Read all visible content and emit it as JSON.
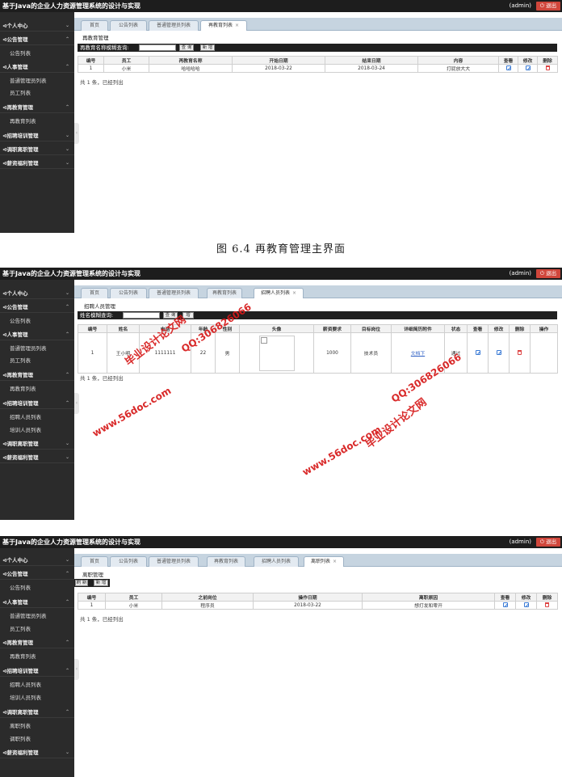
{
  "app": {
    "title": "基于Java的企业人力资源管理系统的设计与实现",
    "user": "(admin)",
    "logout": "退出"
  },
  "sidebar_groups": {
    "personal": "个人中心",
    "notice": "公告管理",
    "notice_list": "公告列表",
    "hr": "人事管理",
    "hr_admins": "普通管理员列表",
    "hr_employees": "员工列表",
    "reedu": "再教育管理",
    "reedu_list": "再教育列表",
    "recruit": "招聘培训管理",
    "recruit_list": "招聘人员列表",
    "train_list": "培训人员列表",
    "transfer": "调职离职管理",
    "leave_list": "离职列表",
    "transfer_list": "调职列表",
    "salary": "薪资福利管理"
  },
  "tabs": {
    "home": "首页",
    "notice": "公告列表",
    "admins": "普通管理员列表",
    "reedu": "再教育列表",
    "recruit": "招聘人员列表",
    "leave": "离职列表"
  },
  "screen1": {
    "pane_title": "再教育管理",
    "search_label": "再教育名称模糊查询:",
    "query": "查 询",
    "add": "新 增",
    "headers": [
      "编号",
      "员工",
      "再教育名称",
      "开始日期",
      "结束日期",
      "内容",
      "查看",
      "修改",
      "删除"
    ],
    "row": {
      "id": "1",
      "employee": "小米",
      "name": "哈哈哈哈",
      "start": "2018-03-22",
      "end": "2018-03-24",
      "content": "打屁放大大"
    },
    "footer": "共 1 条，已经列出"
  },
  "caption": "图 6.4  再教育管理主界面",
  "screen2": {
    "pane_title": "招聘人员管理",
    "search_label": "姓名模糊查询:",
    "query": "查 询",
    "add": "增",
    "headers": [
      "编号",
      "姓名",
      "电话",
      "年龄",
      "性别",
      "头像",
      "薪资要求",
      "目标岗位",
      "详细简历附件",
      "状态",
      "查看",
      "修改",
      "删除",
      "操作"
    ],
    "row": {
      "id": "1",
      "name": "王小明",
      "phone": "1111111",
      "age": "22",
      "gender": "男",
      "salary": "1000",
      "position": "技术员",
      "file": "文档下",
      "status": "通过"
    },
    "footer": "共 1 条，已经列出"
  },
  "screen3": {
    "pane_title": "离职管理",
    "refresh": "刷 新",
    "add": "新 增",
    "headers": [
      "编号",
      "员工",
      "之前岗位",
      "操作日期",
      "离职原因",
      "查看",
      "修改",
      "删除"
    ],
    "row": {
      "id": "1",
      "employee": "小米",
      "prev_position": "程序员",
      "date": "2018-03-22",
      "reason": "想打发和零开"
    },
    "footer": "共 1 条，已经列出"
  },
  "watermarks": {
    "site": "www.56doc.com",
    "qq": "QQ:306826066",
    "cn": "毕业设计论文网"
  },
  "colors": {
    "topbar": "#1d1d1d",
    "sidebar": "#2b2b2b",
    "logout": "#d0463b",
    "watermark": "#d61818",
    "tabbar": "#c6d4e0"
  }
}
